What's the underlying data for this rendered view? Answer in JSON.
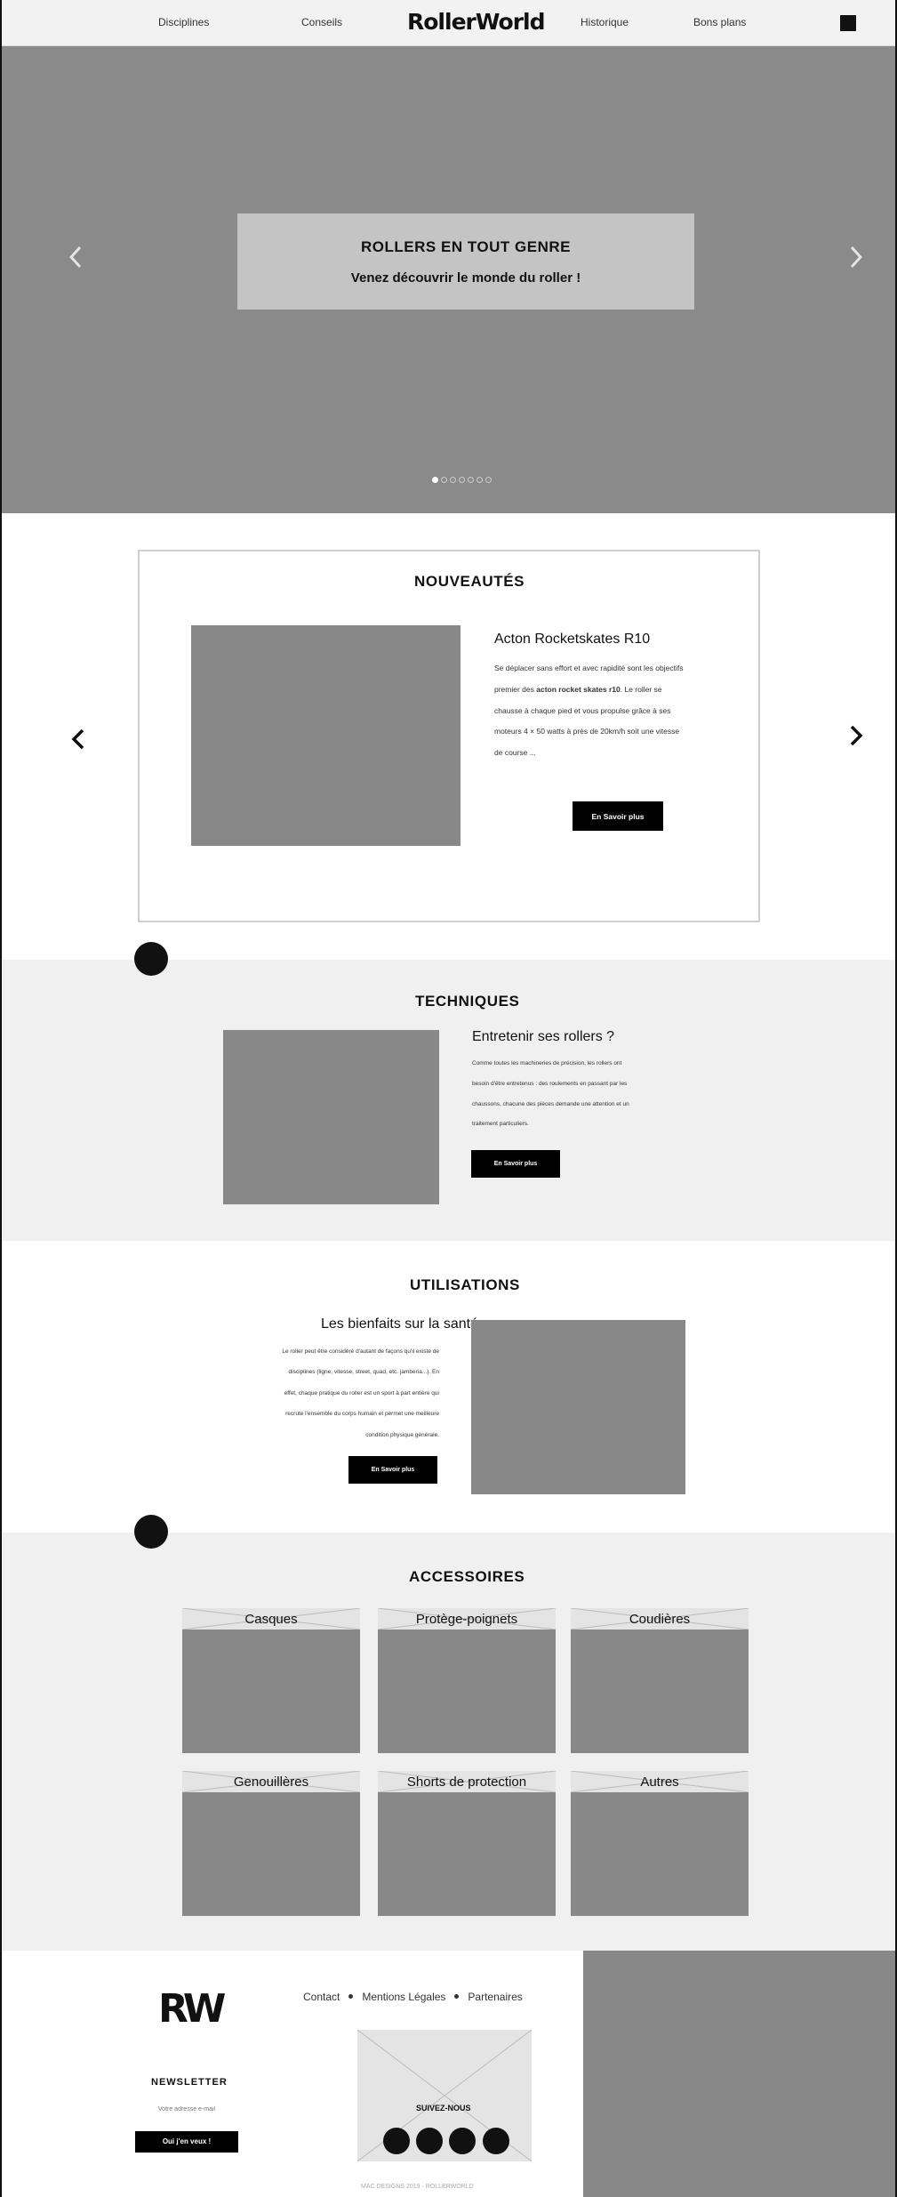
{
  "nav": {
    "links": [
      "Disciplines",
      "Conseils",
      "Historique",
      "Bons plans"
    ],
    "logo": "RollerWorld",
    "cart_icon": "square-black-icon"
  },
  "hero": {
    "title": "ROLLERS EN TOUT GENRE",
    "subtitle": "Venez découvrir le monde du roller !",
    "prev_icon": "chevron-left-icon",
    "next_icon": "chevron-right-icon",
    "slide_count": 7,
    "active_slide": 1
  },
  "nouveautes": {
    "title": "NOUVEAUTÉS",
    "product_title": "Acton Rocketskates R10",
    "text_lines": [
      "Se déplacer sans effort et avec rapidité sont les objectifs",
      "premier des acton rocket skates r10. Le roller se",
      "chausse à chaque pied et vous propulse grâce à ses",
      "moteurs 4 × 50 watts à près de 20km/h soit une vitesse",
      "de course ..."
    ],
    "bold_phrase": "acton rocket skates r10",
    "button": "En Savoir plus",
    "prev_icon": "chevron-left-icon",
    "next_icon": "chevron-right-icon"
  },
  "techniques": {
    "title": "TECHNIQUES",
    "subtitle": "Entretenir ses rollers ?",
    "text_lines": [
      "Comme toutes les machineries de précision, les rollers ont",
      "besoin d'être entretenus : des roulements en passant par les",
      "chaussons, chacune des pièces demande une attention et un",
      "traitement particuliers."
    ],
    "button": "En Savoir plus"
  },
  "utilisations": {
    "title": "UTILISATIONS",
    "subtitle": "Les bienfaits sur la santé",
    "text_lines": [
      "Le roller peut être considéré d'autant de façons qu'il existe de",
      "disciplines (ligne, vitesse, street, quad, etc. jamberia...). En",
      "effet, chaque pratique du roller est un sport à part entière qui",
      "recrute l'ensemble du corps humain et permet une meilleure",
      "condition physique générale."
    ],
    "button": "En Savoir plus"
  },
  "accessoires": {
    "title": "ACCESSOIRES",
    "items": [
      "Casques",
      "Protège-poignets",
      "Coudières",
      "Genouillères",
      "Shorts de protection",
      "Autres"
    ]
  },
  "footer": {
    "logo": "RW",
    "links": [
      "Contact",
      "Mentions Légales",
      "Partenaires"
    ],
    "newsletter_title": "NEWSLETTER",
    "newsletter_placeholder": "Votre adresse e-mail",
    "newsletter_button": "Oui j'en veux !",
    "follow": "SUIVEZ-NOUS",
    "social_icons": [
      "facebook-icon",
      "twitter-icon",
      "instagram-icon",
      "youtube-icon"
    ],
    "copyright": "MAC DESIGNS 2019 - ROLLERWORLD"
  },
  "colors": {
    "placeholder": "#888888",
    "hero_bg": "#8a8a8a",
    "band_bg": "#f0f0f0",
    "button_bg": "#000000"
  }
}
